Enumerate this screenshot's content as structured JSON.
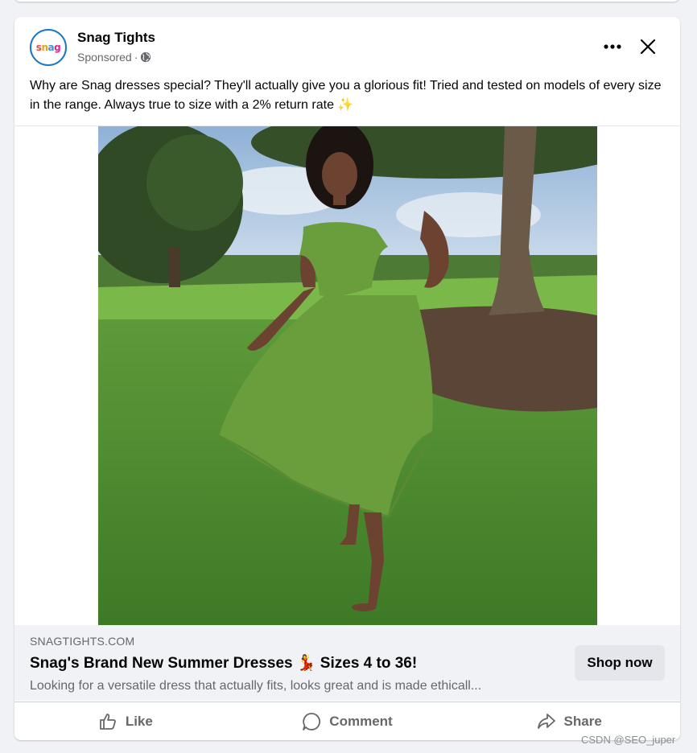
{
  "post": {
    "page_name": "Snag Tights",
    "meta_label": "Sponsored",
    "meta_separator": "·",
    "avatar_logo_text": "snag",
    "body_text": "Why are Snag dresses special? They'll actually give you a glorious fit! Tried and tested on models of every size in the range. Always true to size with a 2% return rate ✨"
  },
  "icons": {
    "more": "more-horizontal-icon",
    "close": "close-icon",
    "globe": "globe-icon",
    "like": "thumbs-up-icon",
    "comment": "comment-bubble-icon",
    "share": "share-arrow-icon"
  },
  "image": {
    "description_tag": "woman-in-green-dress-on-lawn"
  },
  "link_preview": {
    "domain": "SNAGTIGHTS.COM",
    "title": "Snag's Brand New Summer Dresses 💃 Sizes 4 to 36!",
    "description": "Looking for a versatile dress that actually fits, looks great and is made ethicall...",
    "cta_label": "Shop now"
  },
  "actions": {
    "like_label": "Like",
    "comment_label": "Comment",
    "share_label": "Share"
  },
  "watermark": "CSDN @SEO_juper",
  "colors": {
    "text_primary": "#050505",
    "text_secondary": "#65676b",
    "preview_bg": "#f0f2f5",
    "button_bg": "#e4e6eb",
    "dress_green": "#6a9e3d"
  }
}
